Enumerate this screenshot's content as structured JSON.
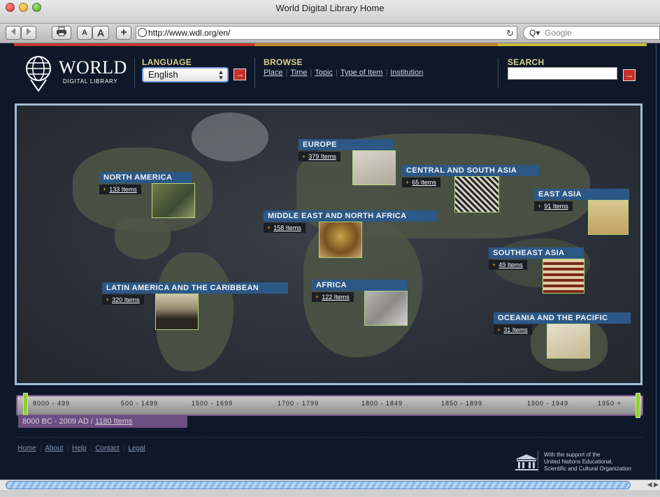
{
  "window": {
    "title": "World Digital Library Home"
  },
  "toolbar": {
    "text_smaller": "A",
    "text_bigger": "A",
    "add": "+",
    "url": "http://www.wdl.org/en/",
    "search_placeholder": "Google"
  },
  "header": {
    "logo_big": "WORLD",
    "logo_small": "DIGITAL LIBRARY",
    "language_label": "LANGUAGE",
    "language_value": "English",
    "browse_label": "BROWSE",
    "browse_links": [
      "Place",
      "Time",
      "Topic",
      "Type of Item",
      "Institution"
    ],
    "search_label": "SEARCH",
    "go_glyph": "→"
  },
  "regions": [
    {
      "name": "NORTH AMERICA",
      "count": "133 Items"
    },
    {
      "name": "EUROPE",
      "count": "379 Items"
    },
    {
      "name": "CENTRAL AND SOUTH ASIA",
      "count": "65 Items"
    },
    {
      "name": "EAST ASIA",
      "count": "91 Items"
    },
    {
      "name": "MIDDLE EAST AND NORTH AFRICA",
      "count": "158 Items"
    },
    {
      "name": "SOUTHEAST ASIA",
      "count": "49 Items"
    },
    {
      "name": "LATIN AMERICA AND THE CARIBBEAN",
      "count": "320 Items"
    },
    {
      "name": "AFRICA",
      "count": "122 Items"
    },
    {
      "name": "OCEANIA AND THE PACIFIC",
      "count": "31 Items"
    }
  ],
  "timeline": {
    "ticks": [
      "8000 - 499",
      "500 - 1499",
      "1500 - 1699",
      "1700 - 1799",
      "1800 - 1849",
      "1850 - 1899",
      "1900 - 1949",
      "1950 +"
    ],
    "range_text": "8000 BC - 2009 AD / ",
    "range_items": "1180 Items"
  },
  "footer": {
    "links": [
      "Home",
      "About",
      "Help",
      "Contact",
      "Legal"
    ],
    "unesco_text": [
      "With the support of the",
      "United Nations Educational,",
      "Scientific and Cultural Organization"
    ]
  },
  "colors": {
    "page_bg": "#0e1829",
    "region_title": "#2c5887",
    "accent_green": "#8ed031",
    "go_red": "#c8302a",
    "timeline_purple": "#6c4e82"
  }
}
